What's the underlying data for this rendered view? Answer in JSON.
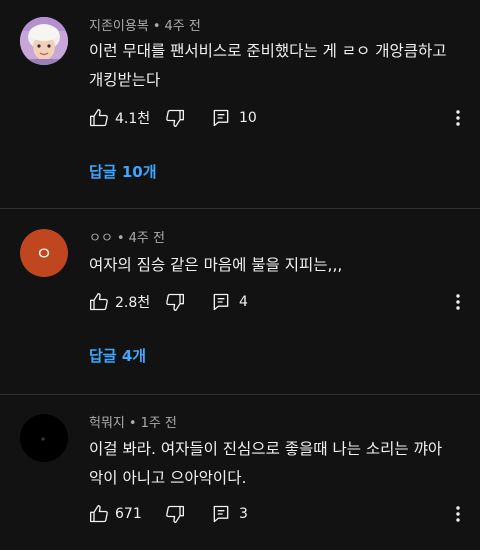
{
  "comments": [
    {
      "author": "지존이용복",
      "time": "4주 전",
      "text_lines": [
        "이런 무대를 팬서비스로 준비했다는 게 ㄹㅇ 개앙큼하고",
        "개킹받는다"
      ],
      "likes": "4.1천",
      "reply_count": "10",
      "replies_link": "답글 10개",
      "avatar_color": "#c9a4d9"
    },
    {
      "author": "ㅇㅇ",
      "time": "4주 전",
      "text_lines": [
        "여자의 짐승 같은 마음에 불을 지피는,,,"
      ],
      "likes": "2.8천",
      "reply_count": "4",
      "replies_link": "답글 4개",
      "avatar_letter": "ㅇ",
      "avatar_color": "#c0461f"
    },
    {
      "author": "헉뭐지",
      "time": "1주 전",
      "text_lines": [
        "이걸 봐라. 여자들이 진심으로 좋을때 나는 소리는 꺄아",
        "악이 아니고 으아악이다."
      ],
      "likes": "671",
      "reply_count": "3",
      "avatar_color": "#000000"
    }
  ],
  "separator": "•",
  "icons": [
    "thumb-up-icon",
    "thumb-down-icon",
    "reply-icon",
    "more-vert-icon"
  ]
}
